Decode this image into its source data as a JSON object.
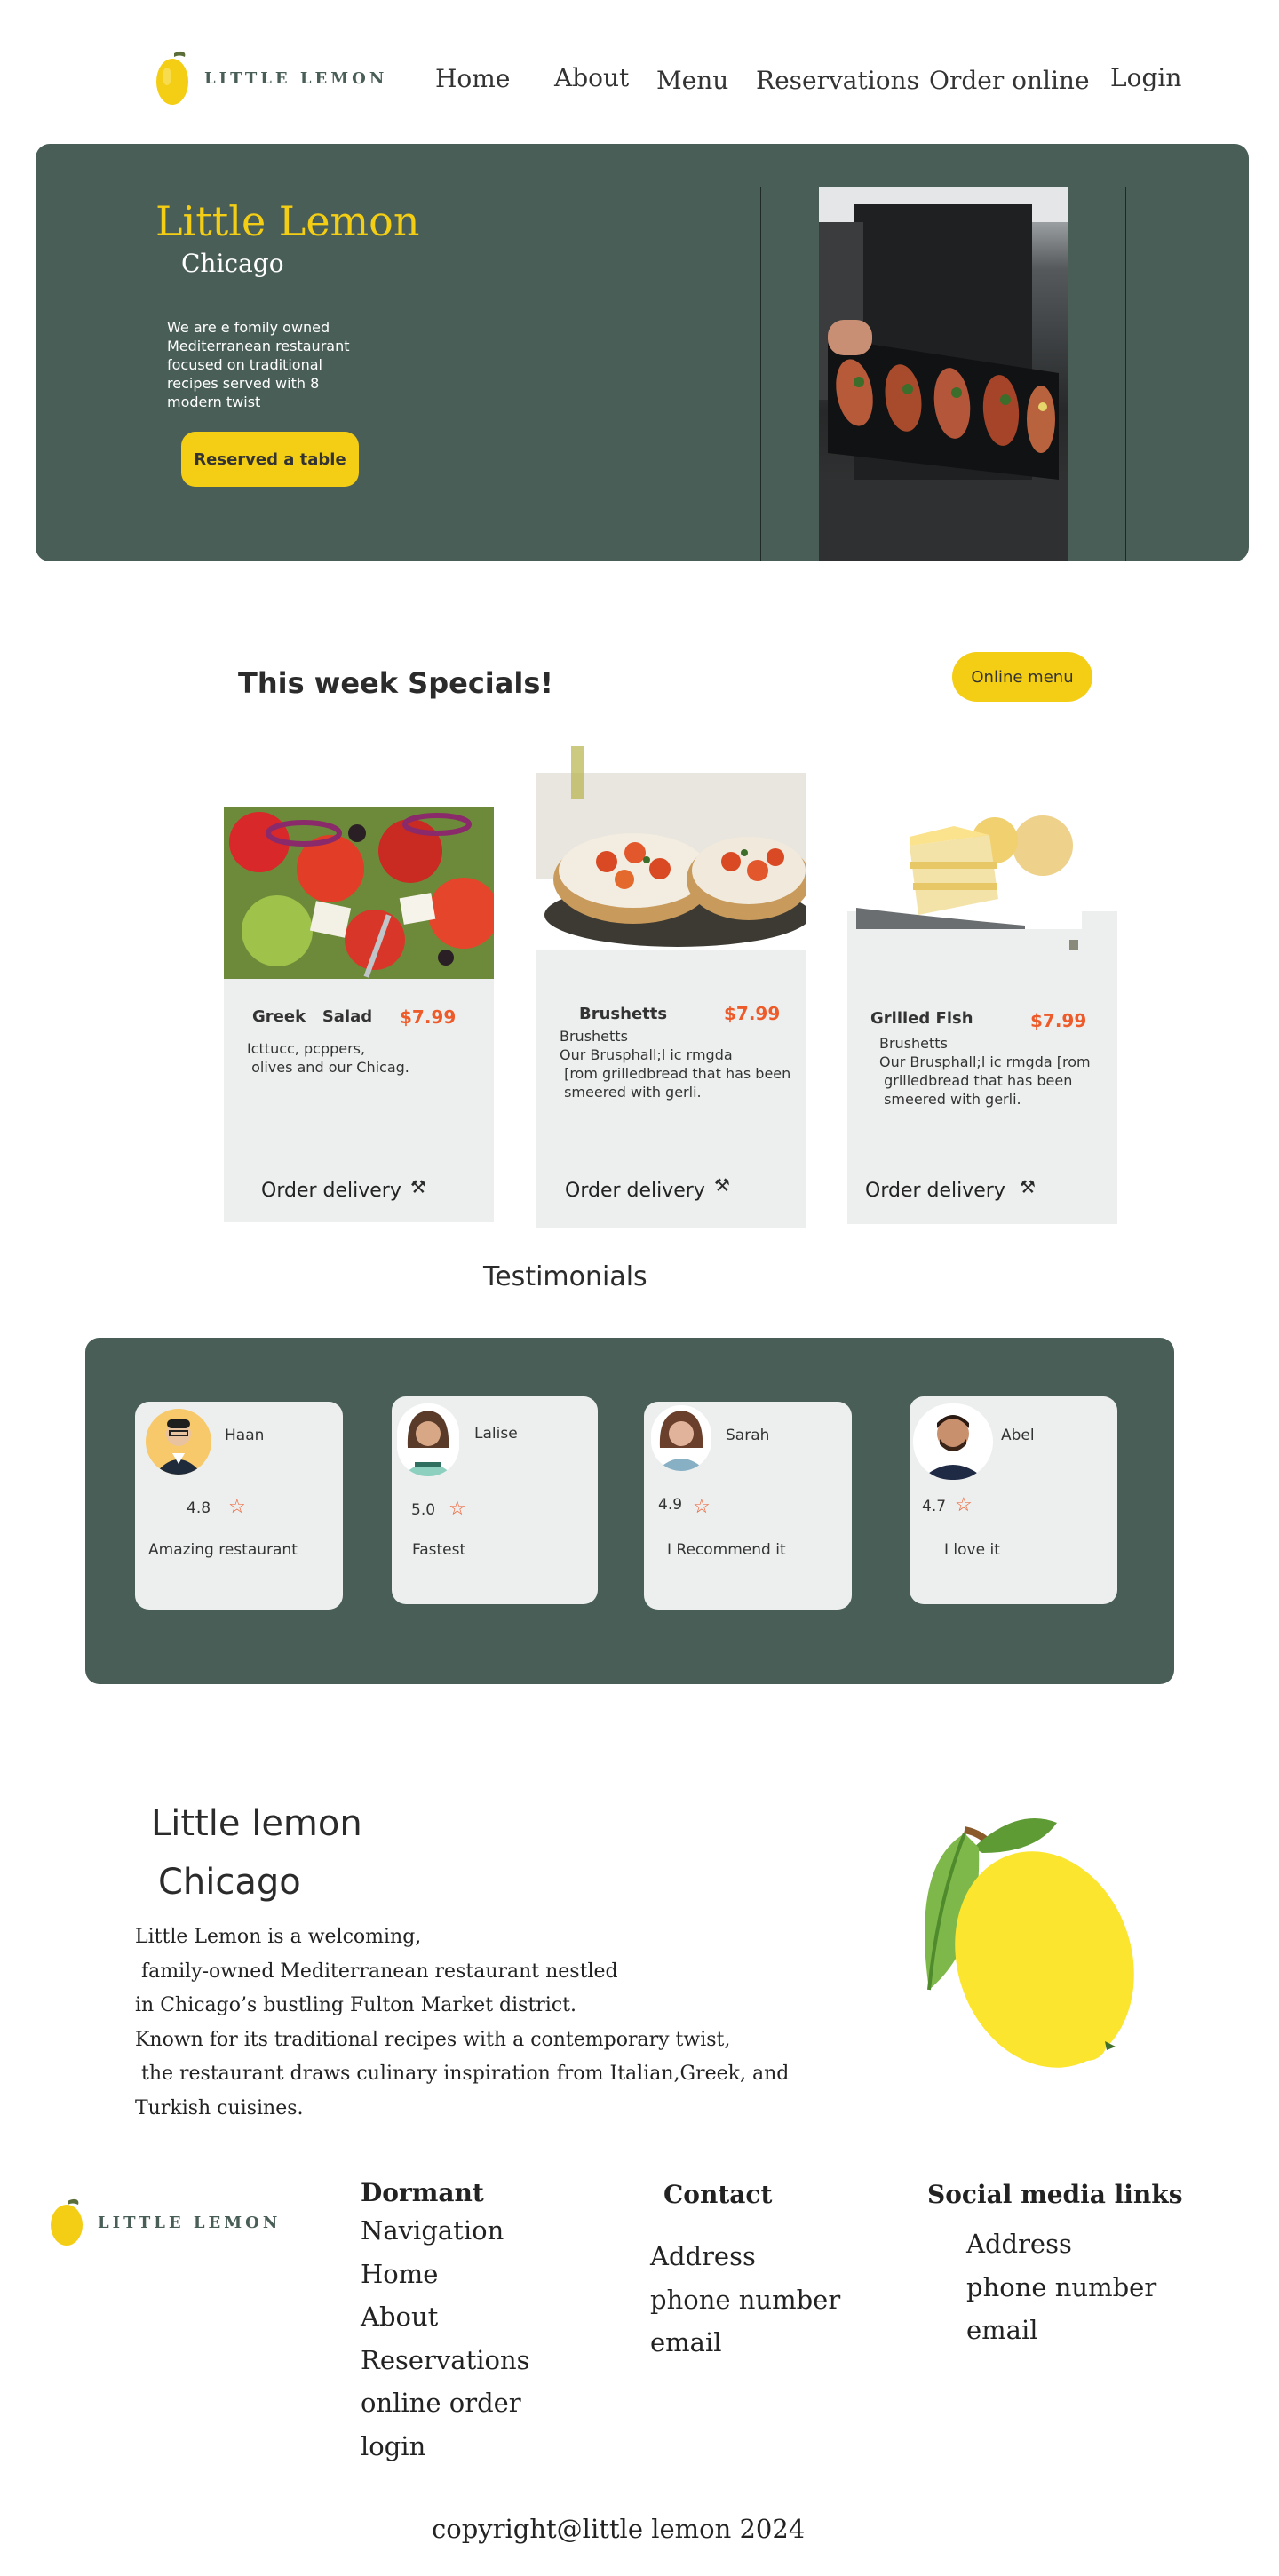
{
  "brand": {
    "logo_text": "LITTLE LEMON"
  },
  "nav": {
    "items": [
      "Home",
      "About",
      "Menu",
      "Reservations",
      "Order online",
      "Login"
    ]
  },
  "hero": {
    "title": "Little Lemon",
    "subtitle": "Chicago",
    "description": "We are e fomily owned Mediterranean restaurant focused on traditional recipes served with 8 modern twist",
    "cta_label": "Reserved a table"
  },
  "specials": {
    "title": "This week Specials!",
    "menu_button": "Online menu",
    "cards": [
      {
        "name": "Greek   Salad",
        "price": "$7.99",
        "desc": "Icttucc, pcppers,\n olives and our Chicag.",
        "order": "Order delivery"
      },
      {
        "name": "Brushetts",
        "price": "$7.99",
        "desc": "Brushetts\nOur Brusphall;l ic rmgda\n [rom grilledbread that has been\n smeered with gerli.",
        "order": "Order delivery"
      },
      {
        "name": "Grilled Fish",
        "price": "$7.99",
        "desc": "Brushetts\nOur Brusphall;l ic rmgda [rom\n grilledbread that has been\n smeered with gerli.",
        "order": "Order delivery"
      }
    ]
  },
  "testimonials": {
    "title": "Testimonials",
    "items": [
      {
        "name": "Haan",
        "rating": "4.8",
        "text": "Amazing restaurant"
      },
      {
        "name": "Lalise",
        "rating": "5.0",
        "text": "Fastest"
      },
      {
        "name": "Sarah",
        "rating": "4.9",
        "text": "I Recommend it"
      },
      {
        "name": "Abel",
        "rating": "4.7",
        "text": "I love it"
      }
    ]
  },
  "about": {
    "title": "Little lemon",
    "subtitle": "Chicago",
    "lines": [
      "Little Lemon is a welcoming,",
      " family-owned Mediterranean restaurant nestled",
      "in Chicago’s bustling Fulton Market district.",
      "Known for its traditional recipes with a contemporary twist,",
      " the restaurant draws culinary inspiration from Italian,Greek, and",
      "Turkish cuisines."
    ]
  },
  "footer": {
    "col1": {
      "title": "Dormant",
      "links": [
        "Navigation",
        "Home",
        "About",
        "Reservations",
        "online order",
        "login"
      ]
    },
    "col2": {
      "title": "Contact",
      "links": [
        "Address",
        "phone number",
        "email"
      ]
    },
    "col3": {
      "title": "Social media links",
      "links": [
        "Address",
        "phone number",
        "email"
      ]
    },
    "copyright": "copyright@little lemon 2024"
  },
  "colors": {
    "primary_green": "#495e57",
    "primary_yellow": "#f4ce14",
    "accent_orange": "#ee5b2b",
    "card_grey": "#edefee"
  }
}
